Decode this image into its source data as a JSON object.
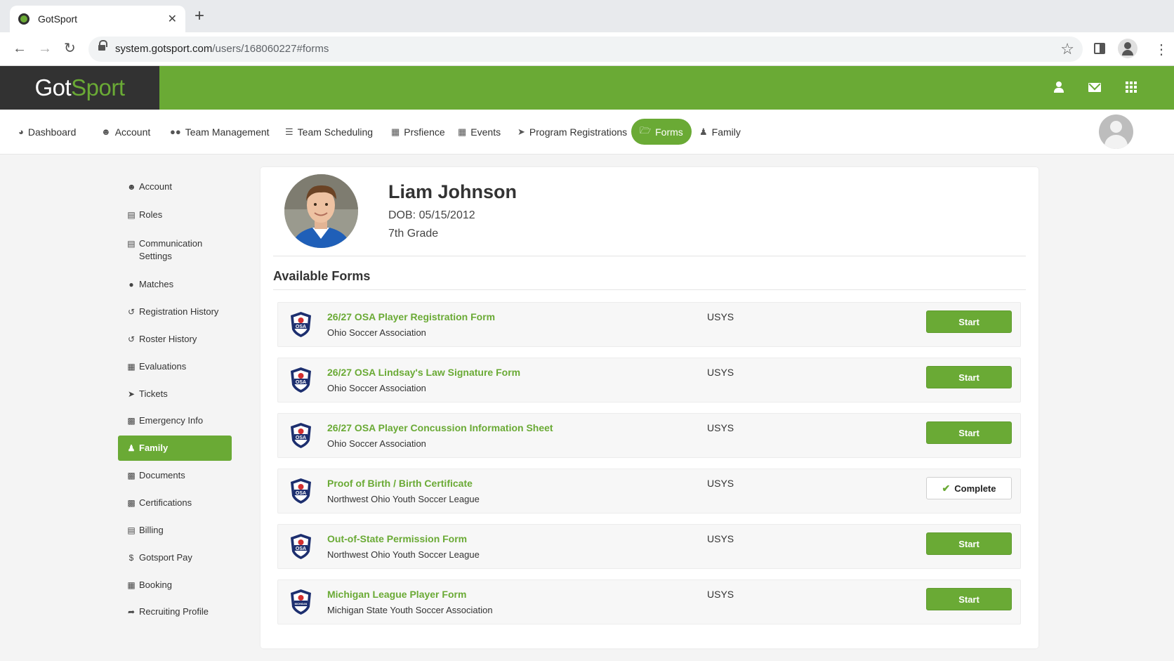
{
  "browser": {
    "tab_title": "GotSport",
    "tab_close": "✕",
    "new_tab": "+",
    "url_domain": "system.gotsport.com",
    "url_path": "/users/168060227#forms"
  },
  "header": {
    "logo_main": "Got",
    "logo_accent": "Sport",
    "brand_color": "#6aaa35",
    "icons": [
      "user-icon",
      "mail-icon",
      "apps-grid-icon"
    ]
  },
  "main_nav": {
    "items": [
      {
        "label": "Dashboard",
        "icon": "dashboard-icon"
      },
      {
        "label": "Account",
        "icon": "account-icon"
      },
      {
        "label": "Team Management",
        "icon": "team-icon"
      },
      {
        "label": "Team Scheduling",
        "icon": "list-icon"
      },
      {
        "label": "Prsfience",
        "icon": "calendar-icon"
      },
      {
        "label": "Events",
        "icon": "calendar-icon"
      },
      {
        "label": "Program Registrations",
        "icon": "rocket-icon"
      },
      {
        "label": "Forms",
        "icon": "folder-icon",
        "active": true
      },
      {
        "label": "Family",
        "icon": "family-icon"
      }
    ]
  },
  "sidebar": {
    "items": [
      {
        "label": "Account",
        "icon": "account-icon"
      },
      {
        "label": "Roles",
        "icon": "table-icon"
      },
      {
        "label": "Communication Settings",
        "icon": "settings-icon"
      },
      {
        "label": "Matches",
        "icon": "team-icon"
      },
      {
        "label": "Registration History",
        "icon": "history-icon"
      },
      {
        "label": "Roster History",
        "icon": "history-icon"
      },
      {
        "label": "Evaluations",
        "icon": "calendar-icon"
      },
      {
        "label": "Tickets",
        "icon": "ticket-icon"
      },
      {
        "label": "Emergency Info",
        "icon": "info-icon"
      },
      {
        "label": "Family",
        "icon": "family-icon",
        "active": true
      },
      {
        "label": "Documents",
        "icon": "folder-icon"
      },
      {
        "label": "Certifications",
        "icon": "folder-icon"
      },
      {
        "label": "Billing",
        "icon": "card-icon"
      },
      {
        "label": "Gotsport Pay",
        "icon": "dollar-icon"
      },
      {
        "label": "Booking",
        "icon": "building-icon"
      },
      {
        "label": "Recruiting Profile",
        "icon": "share-icon"
      }
    ]
  },
  "profile": {
    "name": "Liam Johnson",
    "dob": "DOB: 05/15/2012",
    "grade": "7th Grade"
  },
  "forms_section": {
    "title": "Available Forms",
    "forms": [
      {
        "title": "26/27 OSA Player Registration Form",
        "org": "Ohio Soccer Association",
        "type": "USYS",
        "action": "Start",
        "status": "start",
        "logo_text": "OSA"
      },
      {
        "title": "26/27 OSA Lindsay's Law Signature Form",
        "org": "Ohio Soccer Association",
        "type": "USYS",
        "action": "Start",
        "status": "start",
        "logo_text": "OSA"
      },
      {
        "title": "26/27 OSA Player Concussion Information Sheet",
        "org": "Ohio Soccer Association",
        "type": "USYS",
        "action": "Start",
        "status": "start",
        "logo_text": "OSA"
      },
      {
        "title": "Proof of Birth / Birth Certificate",
        "org": "Northwest Ohio Youth Soccer League",
        "type": "USYS",
        "action": "Complete",
        "status": "complete",
        "logo_text": "OSA"
      },
      {
        "title": "Out-of-State Permission Form",
        "org": "Northwest Ohio Youth Soccer League",
        "type": "USYS",
        "action": "Start",
        "status": "start",
        "logo_text": "OSA"
      },
      {
        "title": "Michigan League Player Form",
        "org": "Michigan State Youth Soccer Association",
        "type": "USYS",
        "action": "Start",
        "status": "start",
        "logo_text": "MICHIGAN"
      }
    ]
  }
}
